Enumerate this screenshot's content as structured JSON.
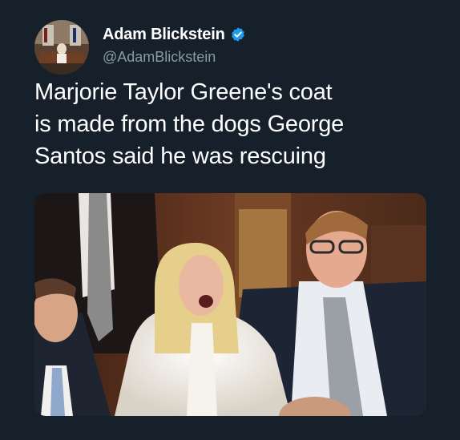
{
  "tweet": {
    "author": {
      "display_name": "Adam Blickstein",
      "handle": "@AdamBlickstein",
      "verified": true,
      "avatar_icon": "profile-photo"
    },
    "text_lines": [
      "Marjorie Taylor Greene's coat",
      "is made from the dogs George",
      "Santos said he was rescuing"
    ],
    "media": {
      "type": "photo",
      "icon": "embedded-photo"
    }
  },
  "colors": {
    "background": "#15202b",
    "text": "#ffffff",
    "handle": "#8b98a5",
    "verified_badge": "#1d9bf0"
  }
}
